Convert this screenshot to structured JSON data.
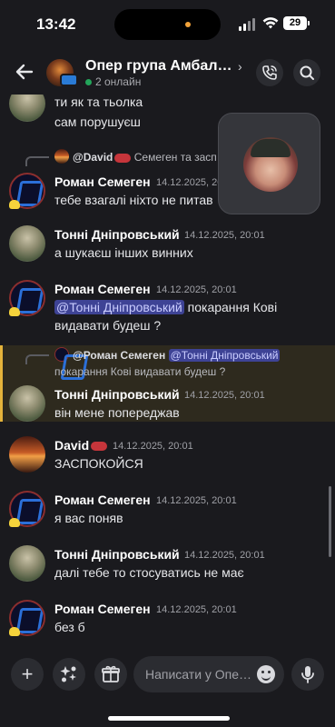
{
  "status_bar": {
    "time": "13:42",
    "battery": "29"
  },
  "header": {
    "title": "Опер група Амбал…",
    "chevron": "›",
    "online": "2 онлайн",
    "call_icon": "phone-icon",
    "search_icon": "search-icon",
    "back_icon": "arrow-left-icon"
  },
  "messages": {
    "m0": {
      "line1": "ти як та тьолка",
      "line2": "сам порушуєш"
    },
    "m1": {
      "reply_name": "@David",
      "reply_text": "Семеген та засп",
      "name": "Роман Семеген",
      "ts": "14.12.2025, 20",
      "text": "тебе взагалі ніхто не питав"
    },
    "m2": {
      "name": "Тонні Дніпровський",
      "ts": "14.12.2025, 20:01",
      "text": "а шукаєш інших винних"
    },
    "m3": {
      "name": "Роман Семеген",
      "ts": "14.12.2025, 20:01",
      "mention": "@Тонні Дніпровський",
      "text_after": "покарання Кові",
      "line2": "видавати будеш ?"
    },
    "m4": {
      "reply_name": "@Роман Семеген",
      "reply_mention": "@Тонні Дніпровський",
      "reply_line2": "покарання Кові видавати будеш ?",
      "name": "Тонні Дніпровський",
      "ts": "14.12.2025, 20:01",
      "text": "він мене попереджав"
    },
    "m5": {
      "name": "David",
      "ts": "14.12.2025, 20:01",
      "text": "ЗАСПОКОЙСЯ"
    },
    "m6": {
      "name": "Роман Семеген",
      "ts": "14.12.2025, 20:01",
      "text": "я вас поняв"
    },
    "m7": {
      "name": "Тонні Дніпровський",
      "ts": "14.12.2025, 20:01",
      "text": "далі тебе то стосуватись не має"
    },
    "m8": {
      "name": "Роман Семеген",
      "ts": "14.12.2025, 20:01",
      "text": "без б"
    }
  },
  "composer": {
    "placeholder": "Написати у Опе…",
    "plus": "+",
    "icons": [
      "plus-icon",
      "sparkle-icon",
      "gift-icon",
      "emoji-icon",
      "microphone-icon"
    ]
  },
  "colors": {
    "background": "#1a1a1e",
    "mention_bg": "#3e4395",
    "highlight_border": "#e4b33b",
    "online": "#23a55a"
  }
}
